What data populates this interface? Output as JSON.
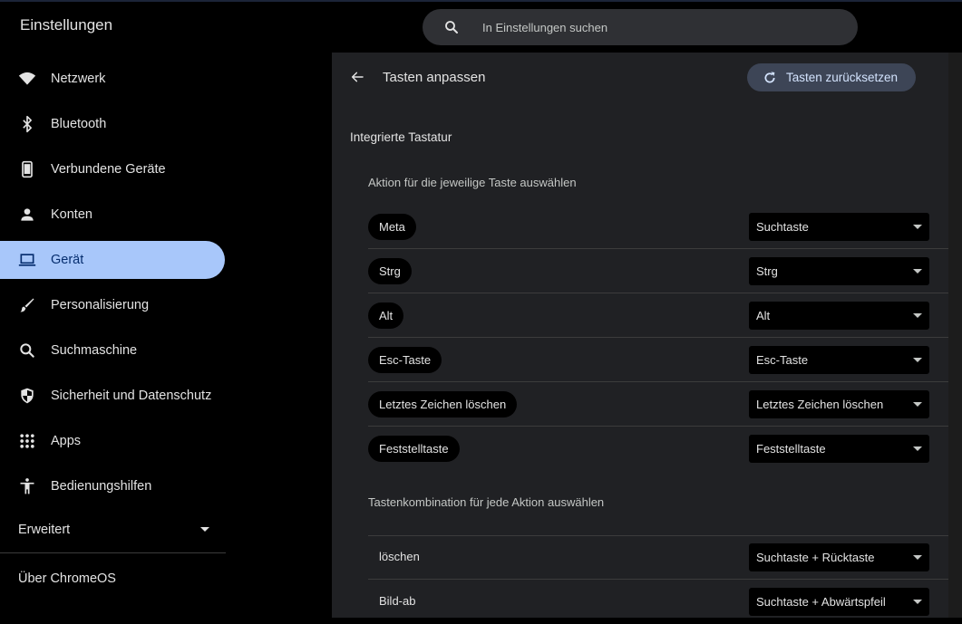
{
  "app": {
    "title": "Einstellungen"
  },
  "search": {
    "placeholder": "In Einstellungen suchen",
    "value": ""
  },
  "sidebar": {
    "items": [
      {
        "label": "Netzwerk",
        "icon": "wifi-icon"
      },
      {
        "label": "Bluetooth",
        "icon": "bluetooth-icon"
      },
      {
        "label": "Verbundene Geräte",
        "icon": "phone-icon"
      },
      {
        "label": "Konten",
        "icon": "person-icon"
      },
      {
        "label": "Gerät",
        "icon": "laptop-icon",
        "active": true
      },
      {
        "label": "Personalisierung",
        "icon": "brush-icon"
      },
      {
        "label": "Suchmaschine",
        "icon": "search-icon"
      },
      {
        "label": "Sicherheit und Datenschutz",
        "icon": "shield-icon"
      },
      {
        "label": "Apps",
        "icon": "apps-grid-icon"
      },
      {
        "label": "Bedienungshilfen",
        "icon": "accessibility-icon"
      }
    ],
    "advanced": "Erweitert",
    "about": "Über ChromeOS"
  },
  "main": {
    "title": "Tasten anpassen",
    "reset_label": "Tasten zurücksetzen",
    "section_title": "Integrierte Tastatur",
    "keys_subtitle": "Aktion für die jeweilige Taste auswählen",
    "key_rows": [
      {
        "key": "Meta",
        "value": "Suchtaste"
      },
      {
        "key": "Strg",
        "value": "Strg"
      },
      {
        "key": "Alt",
        "value": "Alt"
      },
      {
        "key": "Esc-Taste",
        "value": "Esc-Taste"
      },
      {
        "key": "Letztes Zeichen löschen",
        "value": "Letztes Zeichen löschen"
      },
      {
        "key": "Feststelltaste",
        "value": "Feststelltaste"
      }
    ],
    "combo_subtitle": "Tastenkombination für jede Aktion auswählen",
    "combo_rows": [
      {
        "action": "löschen",
        "value": "Suchtaste + Rücktaste"
      },
      {
        "action": "Bild-ab",
        "value": "Suchtaste + Abwärtspfeil"
      }
    ]
  },
  "colors": {
    "active_bg": "#a8c7fa",
    "active_text": "#062e6f",
    "panel_bg": "#202124",
    "reset_bg": "#3d4556"
  }
}
